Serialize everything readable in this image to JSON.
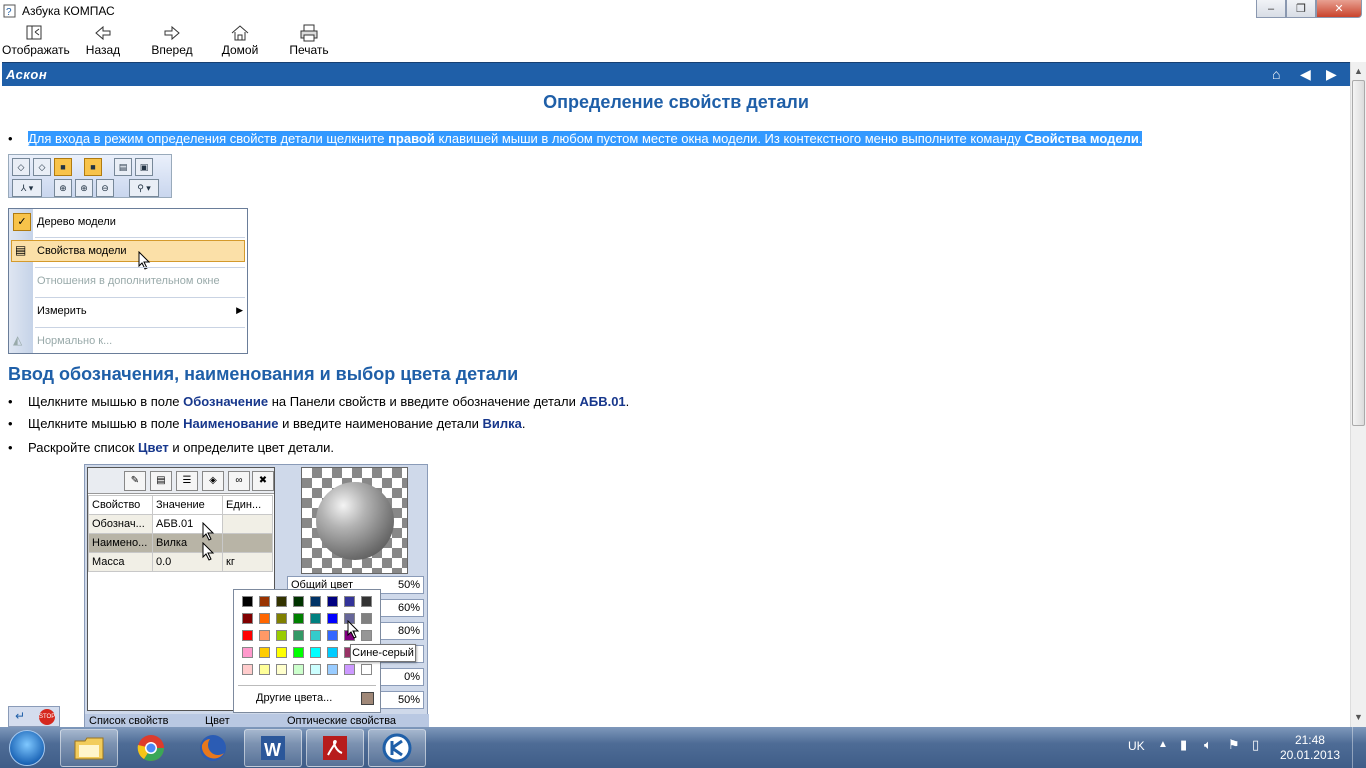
{
  "window": {
    "title": "Азбука КОМПАС",
    "min": "–",
    "max": "❐",
    "close": "✕"
  },
  "toolbar": {
    "show": "Отображать",
    "back": "Назад",
    "forward": "Вперед",
    "home": "Домой",
    "print": "Печать"
  },
  "banner": {
    "logo": "Аскон"
  },
  "page": {
    "title": "Определение свойств детали",
    "intro": {
      "p1": "Для входа в режим определения свойств детали щелкните ",
      "b1": "правой",
      "p2": " клавишей мыши в любом пустом месте окна модели. Из контекстного меню выполните команду ",
      "b2": "Свойства модели",
      "p3": "."
    },
    "context_menu": {
      "items": [
        "Дерево модели",
        "Свойства модели",
        "Отношения в дополнительном окне",
        "Измерить",
        "Нормально к..."
      ]
    },
    "section2": "Ввод обозначения, наименования и выбор цвета детали",
    "b1": {
      "p1": "Щелкните мышью в поле ",
      "k1": "Обозначение",
      "p2": " на Панели свойств и введите обозначение детали ",
      "k2": "АБВ.01",
      "p3": "."
    },
    "b2": {
      "p1": "Щелкните мышью в поле ",
      "k1": "Наименование",
      "p2": " и введите наименование детали ",
      "k2": "Вилка",
      "p3": "."
    },
    "b3": {
      "p1": "Раскройте список ",
      "k1": "Цвет",
      "p2": " и определите цвет детали."
    },
    "props_table": {
      "headers": [
        "Свойство",
        "Значение",
        "Един..."
      ],
      "rows": [
        [
          "Обознач...",
          "АБВ.01",
          ""
        ],
        [
          "Наимено...",
          "Вилка",
          ""
        ],
        [
          "Масса",
          "0.0",
          "кг"
        ]
      ]
    },
    "optical": [
      {
        "label": "Общий цвет",
        "value": "50%"
      },
      {
        "label": "",
        "value": "60%"
      },
      {
        "label": "",
        "value": "80%"
      },
      {
        "label": "",
        "value": ""
      },
      {
        "label": "",
        "value": "0%"
      },
      {
        "label": "",
        "value": "50%"
      }
    ],
    "palette": {
      "colors": [
        [
          "#000000",
          "#993300",
          "#333300",
          "#003300",
          "#003366",
          "#000080",
          "#333399",
          "#333333"
        ],
        [
          "#800000",
          "#ff6600",
          "#808000",
          "#008000",
          "#008080",
          "#0000ff",
          "#666699",
          "#808080"
        ],
        [
          "#ff0000",
          "#ff9966",
          "#99cc00",
          "#339966",
          "#33cccc",
          "#3366ff",
          "#800080",
          "#969696"
        ],
        [
          "#ff99cc",
          "#ffcc00",
          "#ffff00",
          "#00ff00",
          "#00ffff",
          "#00ccff",
          "#993366",
          "#c0c0c0"
        ],
        [
          "#ffcccc",
          "#ffff99",
          "#ffffcc",
          "#ccffcc",
          "#ccffff",
          "#99ccff",
          "#cc99ff",
          "#ffffff"
        ]
      ],
      "other_label": "Другие цвета...",
      "tooltip": "Сине-серый"
    },
    "tabs": {
      "props": "Список свойств",
      "color": "Цвет",
      "optical": "Оптические свойства"
    }
  },
  "taskbar": {
    "lang": "UK",
    "time": "21:48",
    "date": "20.01.2013"
  }
}
